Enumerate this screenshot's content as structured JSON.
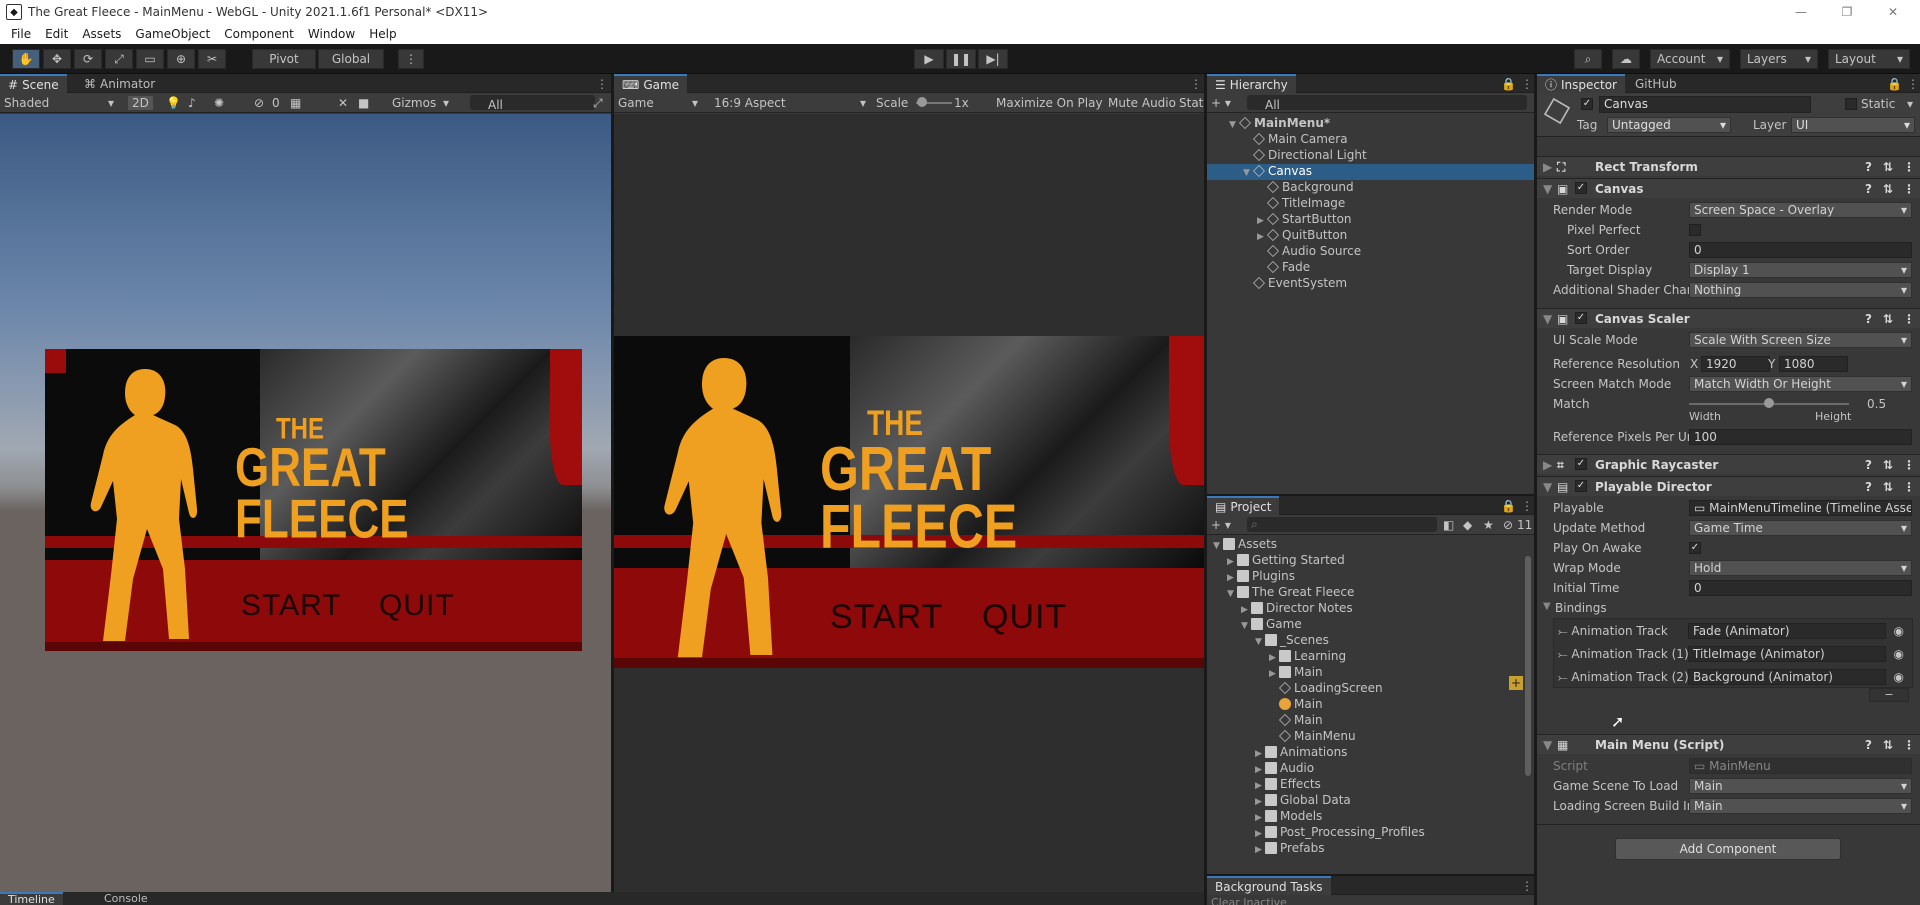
{
  "window": {
    "title": "The Great Fleece - MainMenu - WebGL - Unity 2021.1.6f1 Personal* <DX11>",
    "min": "—",
    "max": "❐",
    "close": "✕"
  },
  "menubar": [
    "File",
    "Edit",
    "Assets",
    "GameObject",
    "Component",
    "Window",
    "Help"
  ],
  "toolbar": {
    "pivot": "Pivot",
    "global": "Global",
    "account": "Account",
    "layers": "Layers",
    "layout": "Layout"
  },
  "scene": {
    "tabs": [
      "Scene",
      "Animator"
    ],
    "shading": "Shaded",
    "mode2d": "2D",
    "gizmos": "Gizmos",
    "search_placeholder": "All",
    "hidden_count": "0"
  },
  "game": {
    "tab": "Game",
    "display": "Game",
    "aspect": "16:9 Aspect",
    "scale_label": "Scale",
    "scale_value": "1x",
    "maximize": "Maximize On Play",
    "mute": "Mute Audio",
    "stats": "Stat"
  },
  "art": {
    "title_the": "THE",
    "title_great": "GREAT",
    "title_fleece": "FLEECE",
    "start": "START",
    "quit": "QUIT"
  },
  "hierarchy": {
    "tab": "Hierarchy",
    "search_placeholder": "All",
    "items": [
      {
        "label": "MainMenu*",
        "depth": 0,
        "arrow": "▼",
        "selected": false
      },
      {
        "label": "Main Camera",
        "depth": 1,
        "arrow": "",
        "selected": false
      },
      {
        "label": "Directional Light",
        "depth": 1,
        "arrow": "",
        "selected": false
      },
      {
        "label": "Canvas",
        "depth": 1,
        "arrow": "▼",
        "selected": true
      },
      {
        "label": "Background",
        "depth": 2,
        "arrow": "",
        "selected": false
      },
      {
        "label": "TitleImage",
        "depth": 2,
        "arrow": "",
        "selected": false
      },
      {
        "label": "StartButton",
        "depth": 2,
        "arrow": "▶",
        "selected": false
      },
      {
        "label": "QuitButton",
        "depth": 2,
        "arrow": "▶",
        "selected": false
      },
      {
        "label": "Audio Source",
        "depth": 2,
        "arrow": "",
        "selected": false
      },
      {
        "label": "Fade",
        "depth": 2,
        "arrow": "",
        "selected": false
      },
      {
        "label": "EventSystem",
        "depth": 1,
        "arrow": "",
        "selected": false
      }
    ]
  },
  "project": {
    "tab": "Project",
    "hidden_count": "11",
    "items": [
      {
        "label": "Assets",
        "depth": 0,
        "arrow": "▼",
        "type": "folder"
      },
      {
        "label": "Getting Started",
        "depth": 1,
        "arrow": "▶",
        "type": "folder"
      },
      {
        "label": "Plugins",
        "depth": 1,
        "arrow": "▶",
        "type": "folder"
      },
      {
        "label": "The Great Fleece",
        "depth": 1,
        "arrow": "▼",
        "type": "folder"
      },
      {
        "label": "Director Notes",
        "depth": 2,
        "arrow": "▶",
        "type": "folder"
      },
      {
        "label": "Game",
        "depth": 2,
        "arrow": "▼",
        "type": "folder"
      },
      {
        "label": "_Scenes",
        "depth": 3,
        "arrow": "▼",
        "type": "folder"
      },
      {
        "label": "Learning",
        "depth": 4,
        "arrow": "▶",
        "type": "folder"
      },
      {
        "label": "Main",
        "depth": 4,
        "arrow": "▶",
        "type": "folder"
      },
      {
        "label": "LoadingScreen",
        "depth": 4,
        "arrow": "",
        "type": "scene"
      },
      {
        "label": "Main",
        "depth": 4,
        "arrow": "",
        "type": "lighting"
      },
      {
        "label": "Main",
        "depth": 4,
        "arrow": "",
        "type": "scene"
      },
      {
        "label": "MainMenu",
        "depth": 4,
        "arrow": "",
        "type": "scene"
      },
      {
        "label": "Animations",
        "depth": 3,
        "arrow": "▶",
        "type": "folder"
      },
      {
        "label": "Audio",
        "depth": 3,
        "arrow": "▶",
        "type": "folder"
      },
      {
        "label": "Effects",
        "depth": 3,
        "arrow": "▶",
        "type": "folder"
      },
      {
        "label": "Global Data",
        "depth": 3,
        "arrow": "▶",
        "type": "folder"
      },
      {
        "label": "Models",
        "depth": 3,
        "arrow": "▶",
        "type": "folder"
      },
      {
        "label": "Post_Processing_Profiles",
        "depth": 3,
        "arrow": "▶",
        "type": "folder"
      },
      {
        "label": "Prefabs",
        "depth": 3,
        "arrow": "▶",
        "type": "folder"
      }
    ]
  },
  "bgtasks": {
    "tab": "Background Tasks",
    "sub": "Clear Inactive"
  },
  "bottom": {
    "timeline": "Timeline",
    "console": "Console"
  },
  "inspector": {
    "tabs": [
      "Inspector",
      "GitHub"
    ],
    "object_name": "Canvas",
    "static_label": "Static",
    "tag_label": "Tag",
    "tag_value": "Untagged",
    "layer_label": "Layer",
    "layer_value": "UI",
    "rect_transform": "Rect Transform",
    "canvas": {
      "title": "Canvas",
      "props": [
        {
          "label": "Render Mode",
          "value": "Screen Space - Overlay",
          "dd": true
        },
        {
          "label": "Pixel Perfect",
          "value": "",
          "check": true,
          "indent": true
        },
        {
          "label": "Sort Order",
          "value": "0",
          "dd": false,
          "indent": true
        },
        {
          "label": "Target Display",
          "value": "Display 1",
          "dd": true,
          "indent": true
        },
        {
          "label": "Additional Shader Chan",
          "value": "Nothing",
          "dd": true
        }
      ]
    },
    "canvas_scaler": {
      "title": "Canvas Scaler",
      "ui_scale_label": "UI Scale Mode",
      "ui_scale_value": "Scale With Screen Size",
      "ref_res_label": "Reference Resolution",
      "ref_x_label": "X",
      "ref_x": "1920",
      "ref_y_label": "Y",
      "ref_y": "1080",
      "match_mode_label": "Screen Match Mode",
      "match_mode_value": "Match Width Or Height",
      "match_label": "Match",
      "match_value": "0.5",
      "match_fraction": 0.5,
      "width_label": "Width",
      "height_label": "Height",
      "ppu_label": "Reference Pixels Per Ur",
      "ppu_value": "100"
    },
    "graphic_raycaster": "Graphic Raycaster",
    "playable_director": {
      "title": "Playable Director",
      "props": [
        {
          "label": "Playable",
          "value": "MainMenuTimeline (Timeline Asse",
          "dd": false
        },
        {
          "label": "Update Method",
          "value": "Game Time",
          "dd": true
        },
        {
          "label": "Play On Awake",
          "value": "✓",
          "check": true
        },
        {
          "label": "Wrap Mode",
          "value": "Hold",
          "dd": true
        },
        {
          "label": "Initial Time",
          "value": "0",
          "dd": false
        }
      ],
      "bindings_label": "Bindings",
      "bindings": [
        {
          "track": "Animation Track",
          "target": "Fade (Animator)"
        },
        {
          "track": "Animation Track (1)",
          "target": "TitleImage (Animator)"
        },
        {
          "track": "Animation Track (2)",
          "target": "Background (Animator)"
        }
      ]
    },
    "main_menu": {
      "title": "Main Menu (Script)",
      "script_label": "Script",
      "script_value": "MainMenu",
      "scene_label": "Game Scene To Load",
      "scene_value": "Main",
      "loading_label": "Loading Screen Build In",
      "loading_value": "Main"
    },
    "add_component": "Add Component"
  },
  "colors": {
    "accent": "#3a79bb",
    "selected": "#2c5d87",
    "orange": "#f0a020",
    "red": "#8e0a0a"
  }
}
